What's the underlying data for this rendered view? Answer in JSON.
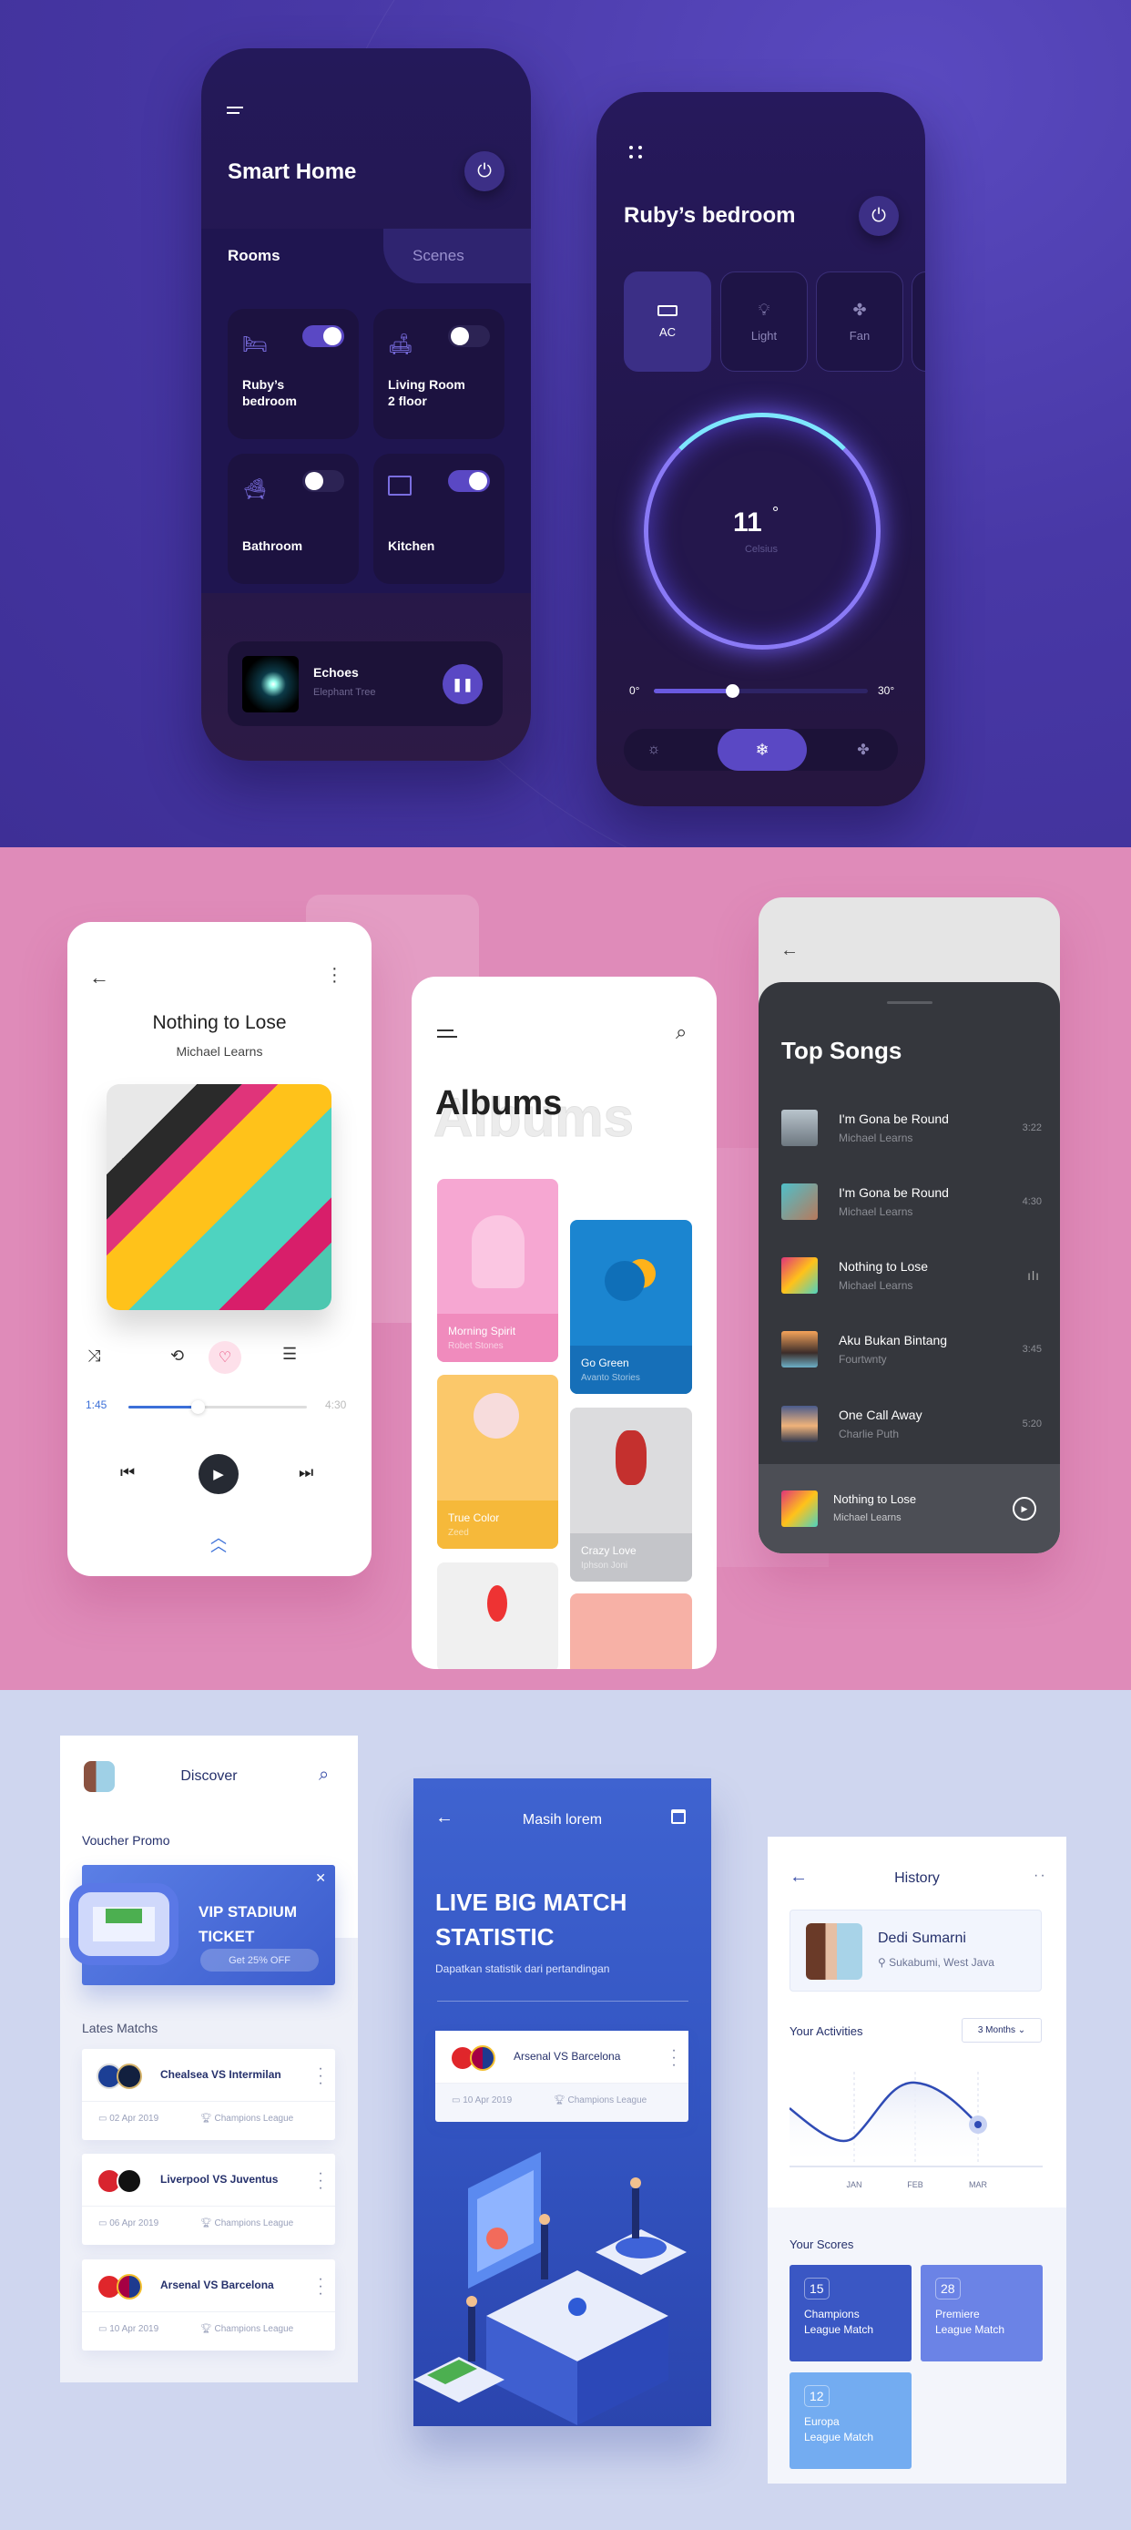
{
  "smart_home": {
    "title": "Smart Home",
    "tabs": [
      "Rooms",
      "Scenes"
    ],
    "rooms": [
      {
        "name": "Ruby’s\nbedroom",
        "on": true
      },
      {
        "name": "Living Room\n2 floor",
        "on": false
      },
      {
        "name": "Bathroom",
        "on": false
      },
      {
        "name": "Kitchen",
        "on": true
      }
    ],
    "now_playing": {
      "title": "Echoes",
      "artist": "Elephant Tree"
    }
  },
  "bedroom": {
    "title": "Ruby’s bedroom",
    "devices": [
      "AC",
      "Light",
      "Fan"
    ],
    "temperature": "11",
    "degree": "°",
    "unit": "Celsius",
    "min_label": "0°",
    "max_label": "30°",
    "slider_value": 11,
    "slider_range": [
      0,
      30
    ]
  },
  "player": {
    "title": "Nothing to Lose",
    "artist": "Michael Learns",
    "elapsed": "1:45",
    "duration": "4:30",
    "progress": 0.39,
    "accent": "#3b6fd8"
  },
  "albums": {
    "title": "Albums",
    "watermark": "Albums",
    "items": [
      {
        "title": "Morning Spirit",
        "artist": "Robet Stones"
      },
      {
        "title": "Go Green",
        "artist": "Avanto Stories"
      },
      {
        "title": "True Color",
        "artist": "Zeed"
      },
      {
        "title": "Crazy Love",
        "artist": "Iphson Joni"
      }
    ]
  },
  "top_songs": {
    "title": "Top Songs",
    "songs": [
      {
        "title": "I'm Gona be Round",
        "artist": "Michael Learns",
        "duration": "3:22"
      },
      {
        "title": "I'm Gona be Round",
        "artist": "Michael Learns",
        "duration": "4:30"
      },
      {
        "title": "Nothing to Lose",
        "artist": "Michael Learns",
        "duration": ""
      },
      {
        "title": "Aku Bukan Bintang",
        "artist": "Fourtwnty",
        "duration": "3:45"
      },
      {
        "title": "One Call Away",
        "artist": "Charlie Puth",
        "duration": "5:20"
      }
    ],
    "now_playing": {
      "title": "Nothing to Lose",
      "artist": "Michael Learns"
    }
  },
  "discover": {
    "title": "Discover",
    "voucher_heading": "Voucher Promo",
    "voucher": {
      "line1": "VIP STADIUM",
      "line2": "TICKET",
      "cta": "Get 25% OFF"
    },
    "matches_heading": "Lates Matchs",
    "matches": [
      {
        "name": "Chealsea VS Intermilan",
        "date": "02 Apr 2019",
        "league": "Champions League"
      },
      {
        "name": "Liverpool VS Juventus",
        "date": "06 Apr 2019",
        "league": "Champions League"
      },
      {
        "name": "Arsenal VS Barcelona",
        "date": "10 Apr 2019",
        "league": "Champions League"
      }
    ]
  },
  "live": {
    "header": "Masih lorem",
    "title_line1": "LIVE BIG MATCH",
    "title_line2": "STATISTIC",
    "subtitle": "Dapatkan statistik dari pertandingan",
    "match": {
      "name": "Arsenal VS Barcelona",
      "date": "10 Apr 2019",
      "league": "Champions League"
    }
  },
  "history": {
    "title": "History",
    "user": {
      "name": "Dedi Sumarni",
      "location": "Sukabumi, West Java"
    },
    "activities_label": "Your Activities",
    "range": "3 Months",
    "months": [
      "JAN",
      "FEB",
      "MAR"
    ],
    "scores_label": "Your Scores",
    "scores": [
      {
        "count": "15",
        "line1": "Champions",
        "line2": "League Match"
      },
      {
        "count": "28",
        "line1": "Premiere",
        "line2": "League Match"
      },
      {
        "count": "12",
        "line1": "Europa",
        "line2": "League Match"
      }
    ]
  }
}
